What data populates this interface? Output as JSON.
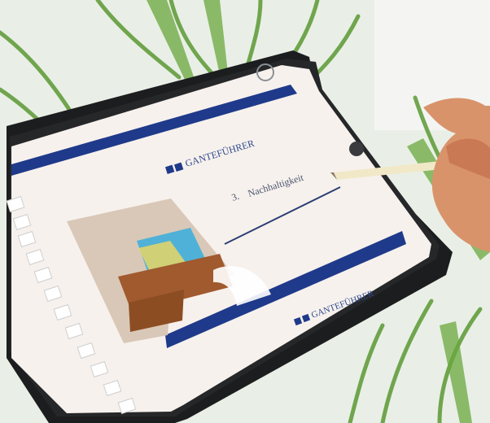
{
  "slide": {
    "section_number": "3.",
    "section_title": "Nachhaltigkeit",
    "brand_name_top": "GANTEFÜHRER",
    "brand_name_bottom": "GANTEFÜHRER"
  },
  "thumbnails": {
    "count": 14
  },
  "colors": {
    "navy_band": "#1f3a8a",
    "tablet_frame": "#1c1d1f",
    "slide_background": "#f7f1ed",
    "foliage": "#4f8a2f",
    "pencil": "#f1e8c8"
  },
  "icons": {
    "sidebar_toggle": "circle-outline-icon",
    "logo_mark": "brand-logo-icon"
  }
}
